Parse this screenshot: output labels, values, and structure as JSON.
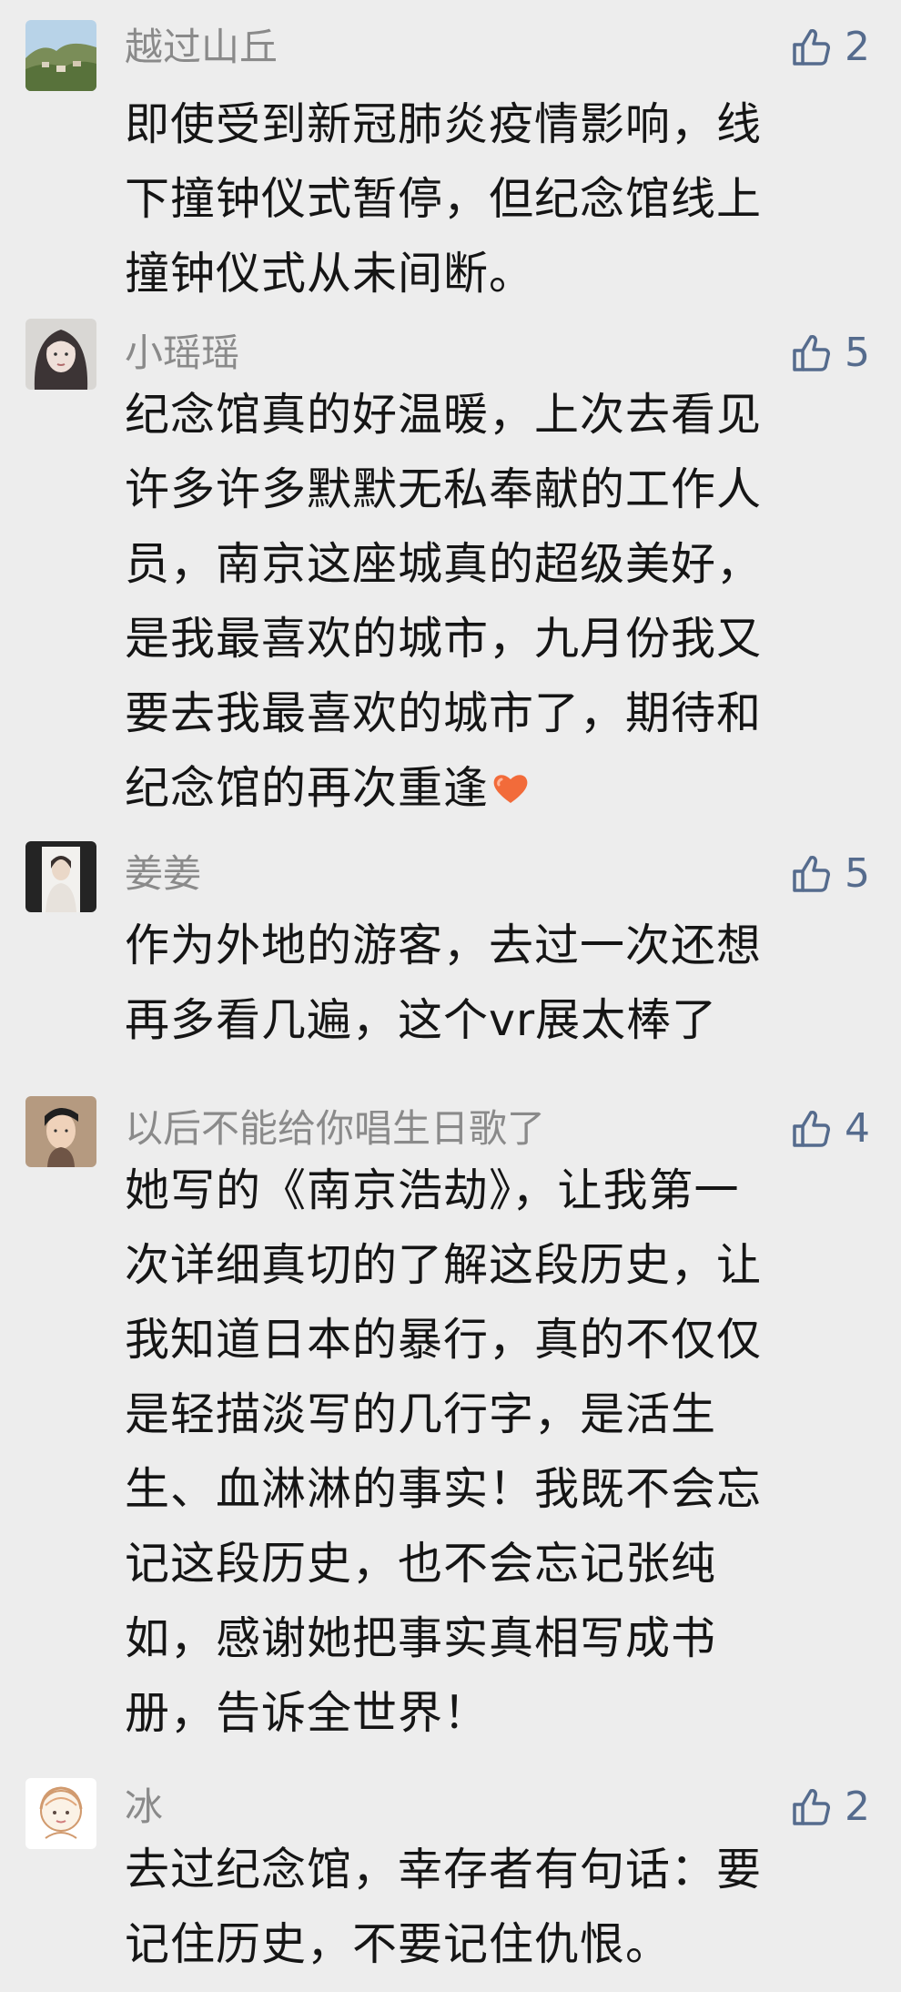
{
  "comments": [
    {
      "username": "越过山丘",
      "likes": "2",
      "lines": [
        "即使受到新冠肺炎疫情影响，线",
        "下撞钟仪式暂停，但纪念馆线上",
        "撞钟仪式从未间断。"
      ],
      "avatar": "landscape-avatar-icon"
    },
    {
      "username": "小瑶瑶",
      "likes": "5",
      "lines": [
        "纪念馆真的好温暖，上次去看见",
        "许多许多默默无私奉献的工作人",
        "员，南京这座城真的超级美好，",
        "是我最喜欢的城市，九月份我又",
        "要去我最喜欢的城市了，期待和",
        "纪念馆的再次重逢"
      ],
      "avatar": "girl-avatar-icon"
    },
    {
      "username": "姜姜",
      "likes": "5",
      "lines": [
        "作为外地的游客，去过一次还想",
        "再多看几遍，这个vr展太棒了"
      ],
      "avatar": "person-avatar-icon"
    },
    {
      "username": "以后不能给你唱生日歌了",
      "likes": "4",
      "lines": [
        "她写的《南京浩劫》，让我第一",
        "次详细真切的了解这段历史，让",
        "我知道日本的暴行，真的不仅仅",
        "是轻描淡写的几行字，是活生",
        "生、血淋淋的事实！我既不会忘",
        "记这段历史，也不会忘记张纯",
        "如，感谢她把事实真相写成书",
        "册，告诉全世界！"
      ],
      "avatar": "boy-avatar-icon"
    },
    {
      "username": "冰",
      "likes": "2",
      "lines": [
        "去过纪念馆，幸存者有句话：要",
        "记住历史，不要记住仇恨。"
      ],
      "avatar": "cartoon-avatar-icon"
    }
  ],
  "icons": {
    "like": "thumbs-up-outline-icon",
    "emoji": "orange-heart-icon"
  },
  "colors": {
    "background": "#ededed",
    "username": "#8a8a8a",
    "like": "#556b8d",
    "text": "#151515",
    "heart": "#f26b3a"
  }
}
